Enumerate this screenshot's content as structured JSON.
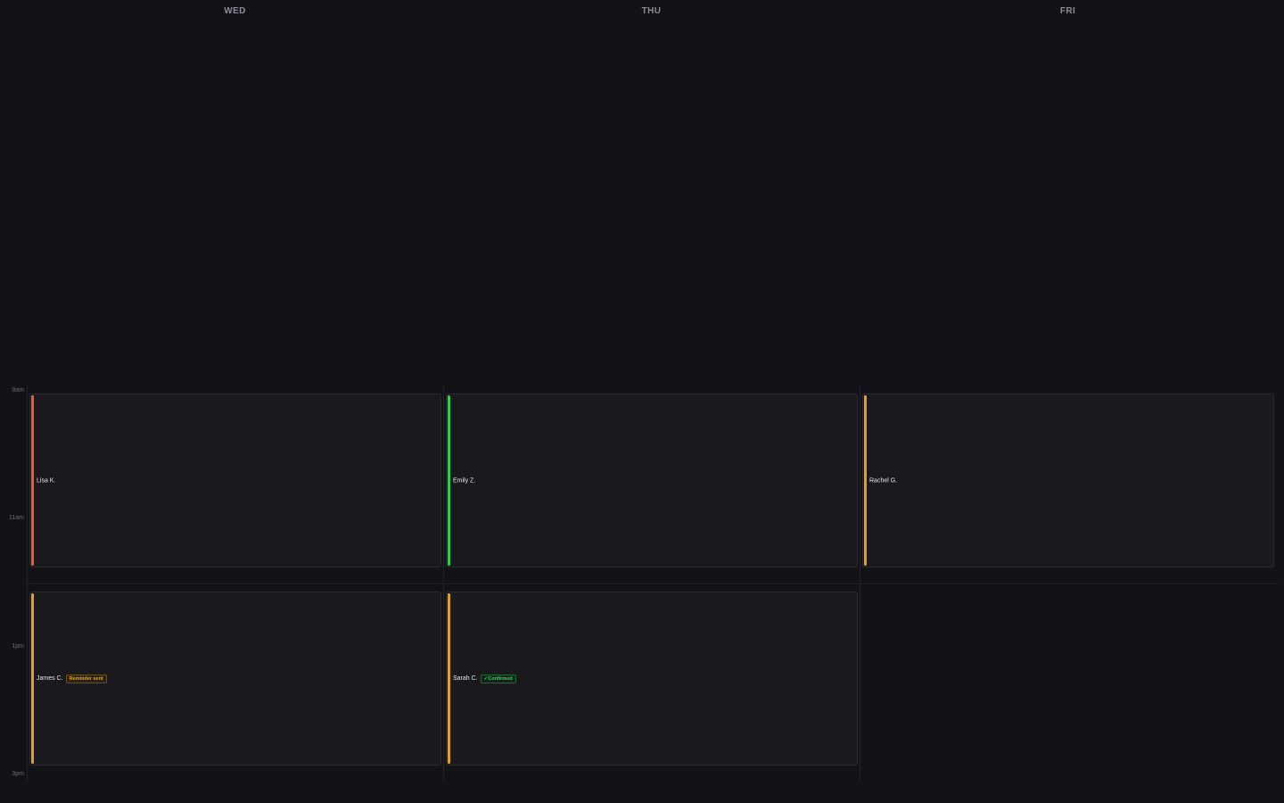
{
  "days": [
    "WED",
    "THU",
    "FRI"
  ],
  "times": [
    "9am",
    "11am",
    "1pm",
    "3pm"
  ],
  "colors": {
    "red": "#ef5b3a",
    "green": "#2ecc55",
    "amber": "#e0a21a"
  },
  "events": [
    {
      "name": "Lisa K.",
      "day": "WED",
      "slot": "morning",
      "accent": "#ef5b3a"
    },
    {
      "name": "Emily Z.",
      "day": "THU",
      "slot": "morning",
      "accent": "#2ecc55"
    },
    {
      "name": "Rachel G.",
      "day": "FRI",
      "slot": "morning",
      "accent": "#e0a21a"
    },
    {
      "name": "James C.",
      "day": "WED",
      "slot": "afternoon",
      "accent": "#e0a21a",
      "badge": "Reminder sent"
    },
    {
      "name": "Sarah C.",
      "day": "THU",
      "slot": "afternoon",
      "accent": "#e0a21a",
      "badge": "✓Confirmed"
    }
  ]
}
